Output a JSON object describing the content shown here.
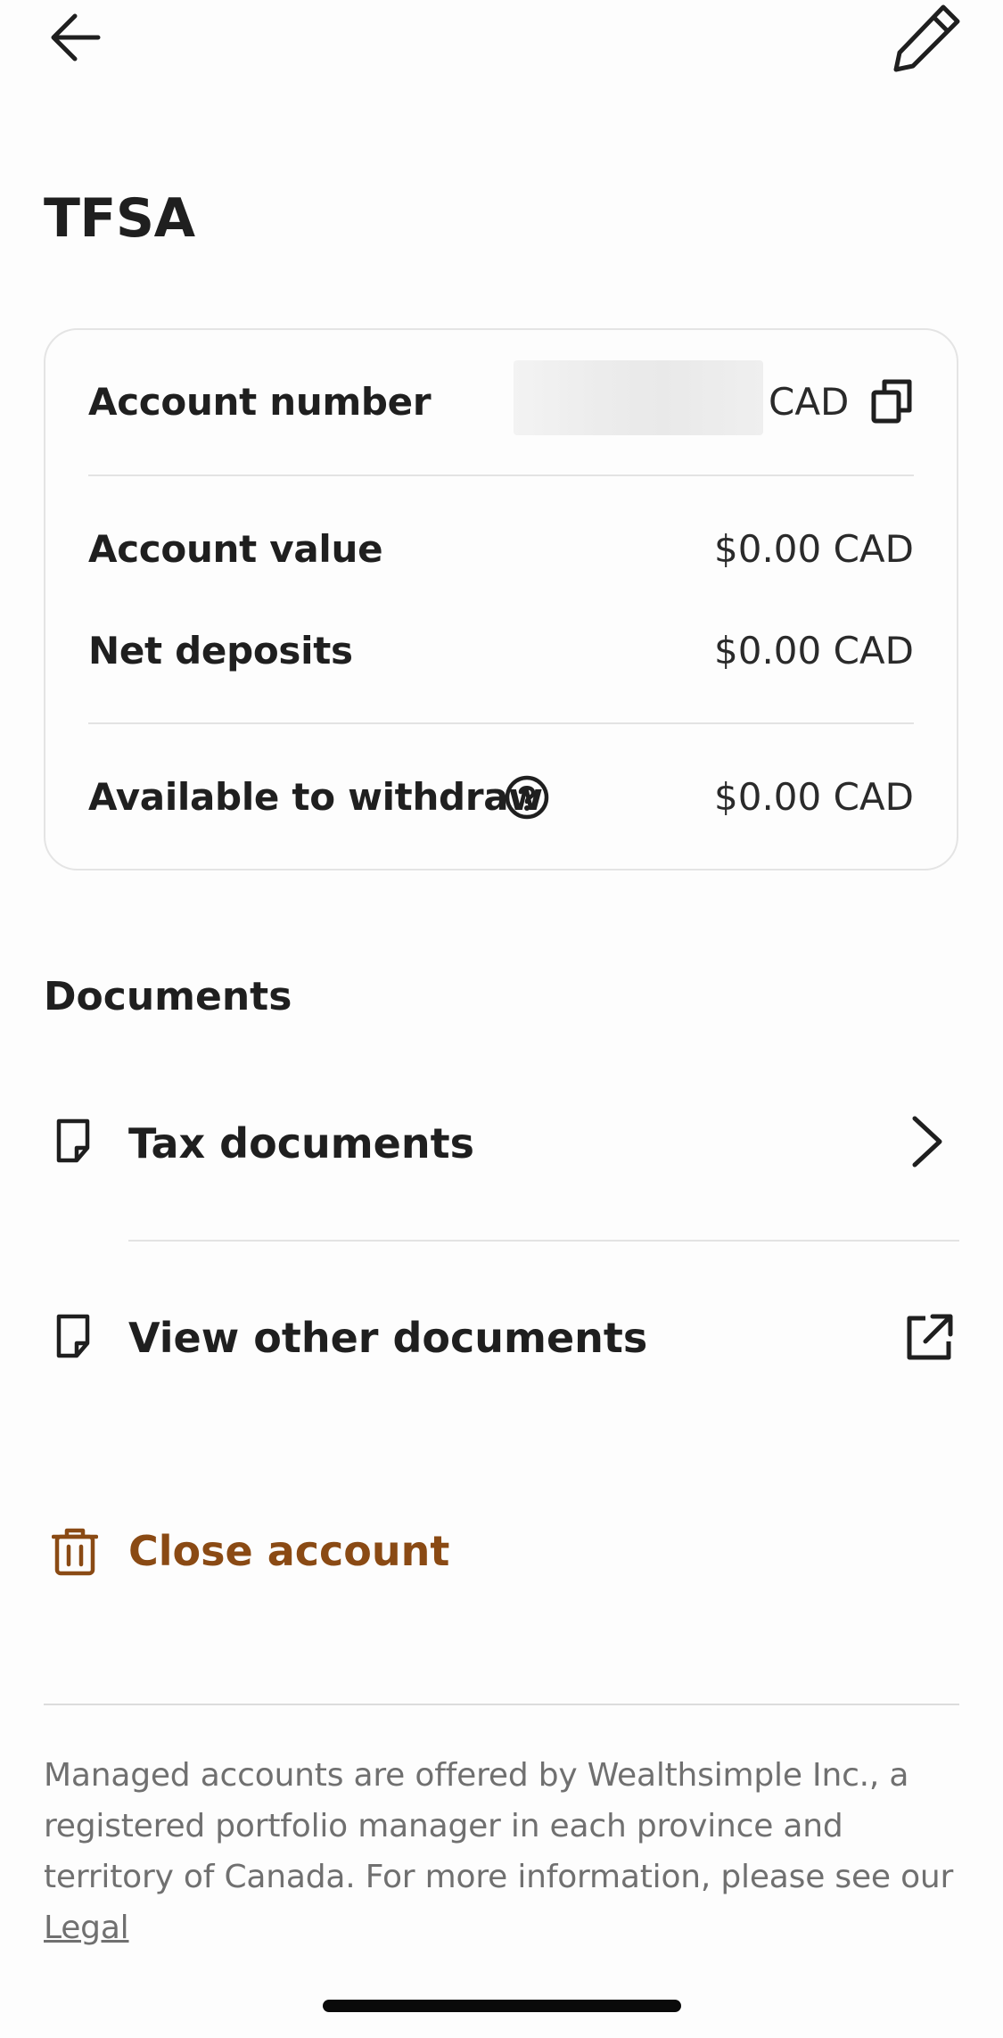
{
  "header": {
    "title": "TFSA"
  },
  "account_card": {
    "account_number_label": "Account number",
    "account_number_currency": "CAD",
    "account_value_label": "Account value",
    "account_value": "$0.00 CAD",
    "net_deposits_label": "Net deposits",
    "net_deposits": "$0.00 CAD",
    "available_label": "Available to withdraw",
    "available_value": "$0.00 CAD"
  },
  "documents": {
    "section_title": "Documents",
    "items": [
      {
        "label": "Tax documents",
        "icon": "document-icon",
        "trailing_icon": "chevron-right-icon"
      },
      {
        "label": "View other documents",
        "icon": "document-icon",
        "trailing_icon": "external-link-icon"
      }
    ]
  },
  "close_account": {
    "label": "Close account",
    "icon": "trash-icon",
    "color": "#8a4a14"
  },
  "footer": {
    "text": "Managed accounts are offered by Wealthsimple Inc., a registered portfolio manager in each province and territory of Canada. For more information, please see our ",
    "link_label": "Legal"
  }
}
